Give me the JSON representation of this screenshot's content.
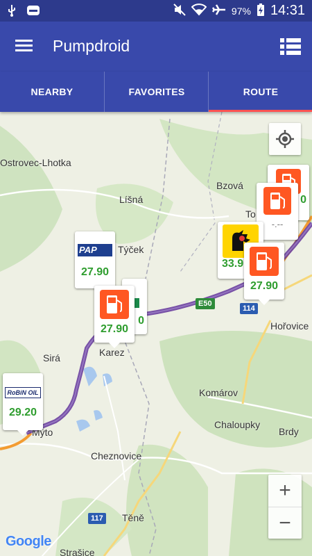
{
  "status": {
    "battery": "97%",
    "time": "14:31",
    "icons": [
      "usb-icon",
      "notification-icon",
      "mute-icon",
      "wifi-icon",
      "airplane-icon",
      "battery-charging-icon"
    ]
  },
  "app": {
    "title": "Pumpdroid"
  },
  "tabs": [
    {
      "label": "NEARBY",
      "active": false
    },
    {
      "label": "FAVORITES",
      "active": false
    },
    {
      "label": "ROUTE",
      "active": true
    }
  ],
  "places": {
    "ostrovec": "Ostrovec-Lhotka",
    "bzova": "Bzová",
    "lisna": "Líšná",
    "tycek": "Týček",
    "to": "To",
    "horovice": "Hořovice",
    "sira": "Sirá",
    "karez": "Karez",
    "komarov": "Komárov",
    "chaloupky": "Chaloupky",
    "brdy": "Brdy",
    "myto": "Mýto",
    "cheznovice": "Cheznovice",
    "tene": "Těně",
    "strasice": "Strašice"
  },
  "roads": {
    "e50": "E50",
    "r114": "114",
    "r117": "117"
  },
  "markers": {
    "pap": {
      "brand": "PAP",
      "price": "27.90"
    },
    "pump_karez": {
      "price": "27.90"
    },
    "behind_karez": {
      "price": "0"
    },
    "robin": {
      "brand": "RoBiN OIL",
      "price": "29.20"
    },
    "agip": {
      "price": "33.9"
    },
    "pump_horovice": {
      "price": "27.90"
    },
    "pump_top": {
      "price": "0"
    },
    "pump_dash": {
      "price": "-.--"
    }
  },
  "map": {
    "attribution": "Google",
    "zoom_in": "+",
    "zoom_out": "−"
  },
  "colors": {
    "appbar": "#3949ab",
    "statusbar": "#2d3a8c",
    "accent": "#ff5252",
    "route": "#6a3f9e",
    "price": "#2e9d2e",
    "pump": "#ff5722"
  }
}
